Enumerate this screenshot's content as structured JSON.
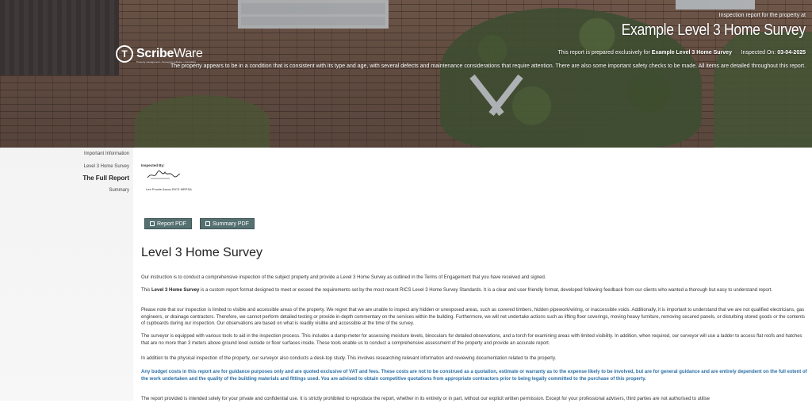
{
  "hero": {
    "brand": {
      "name_bold": "Scribe",
      "name_light": "Ware",
      "tagline": "Property management • Surveying software • Consulting"
    },
    "pre_title": "Inspection report for the property at",
    "title": "Example Level 3 Home Survey",
    "prepared_prefix": "This report is prepared exclusively for",
    "prepared_for": "Example Level 3 Home Survey",
    "inspected_label": "Inspected On:",
    "inspected_date": "03-04-2025",
    "description": "The property appears to be in a condition that is consistent with its type and age, with several defects and maintenance considerations that require attention. There are also some important safety checks to be made. All items are detailed throughout this report."
  },
  "sidebar": {
    "items": [
      {
        "label": "Important Information",
        "active": false
      },
      {
        "label": "Level 3 Home Survey",
        "active": false
      },
      {
        "label": "The Full Report",
        "active": true
      },
      {
        "label": "Summary",
        "active": false
      }
    ]
  },
  "inspector": {
    "label": "Inspected By:",
    "name": "Lee Prowle Assoc.RICS MRPSA"
  },
  "buttons": {
    "report_pdf": "Report PDF",
    "summary_pdf": "Summary PDF"
  },
  "content": {
    "heading": "Level 3 Home Survey",
    "p1": "Our instruction is to conduct a comprehensive inspection of the subject property and provide a Level 3 Home Survey as outlined in the Terms of Engagement that you have received and signed.",
    "p2_pre": "This ",
    "p2_bold1": "Level 3 Home Survey",
    "p2_mid": " is a custom report format designed to meet or exceed the requirements set by the most recent RICS Level 3 Home Survey Standards. It is a clear and user friendly format, developed following feedback from our clients who wanted a thorough but easy to understand report.",
    "p3": "Please note that our inspection is limited to visible and accessible areas of the property. We regret that we are unable to inspect any hidden or unexposed areas, such as covered timbers, hidden pipework/wiring, or inaccessible voids. Additionally, it is important to understand that we are not qualified electricians, gas engineers, or drainage contractors. Therefore, we cannot perform detailed testing or provide in-depth commentary on the services within the building. Furthermore, we will not undertake actions such as lifting floor coverings, moving heavy furniture, removing secured panels, or disturbing stored goods or the contents of cupboards during our inspection. Our observations are based on what is readily visible and accessible at the time of the survey.",
    "p4": "The surveyor is equipped with various tools to aid in the inspection process. This includes a damp-meter for assessing moisture levels, binoculars for detailed observations, and a torch for examining areas with limited visibility. In addition, when required, our surveyor will use a ladder to access flat roofs and hatches that are no more than 3 meters above ground level outside or floor surfaces inside. These tools enable us to conduct a comprehensive assessment of the property and provide an accurate report.",
    "p5": "In addition to the physical inspection of the property, our surveyor also conducts a desk-top study. This involves researching relevant information and reviewing documentation related to the property.",
    "notice": "Any budget costs in this report are for guidance purposes only and are quoted exclusive of VAT and fees. These costs are not to be construed as a quotation, estimate or warranty as to the expense likely to be involved, but are for general guidance and are entirely dependent on the full extent of the work undertaken and the quality of the building materials and fittings used. You are advised to obtain competitive quotations from appropriate contractors prior to being legally committed to the purchase of this property.",
    "p6": "The report provided is intended solely for your private and confidential use. It is strictly prohibited to reproduce the report, whether in its entirety or in part, without our explicit written permission. Except for your professional advisers, third parties are not authorised to utilise"
  },
  "colors": {
    "button_bg": "#557071",
    "notice_text": "#2c6fa5",
    "sidebar_bg": "#f3f3f3"
  }
}
